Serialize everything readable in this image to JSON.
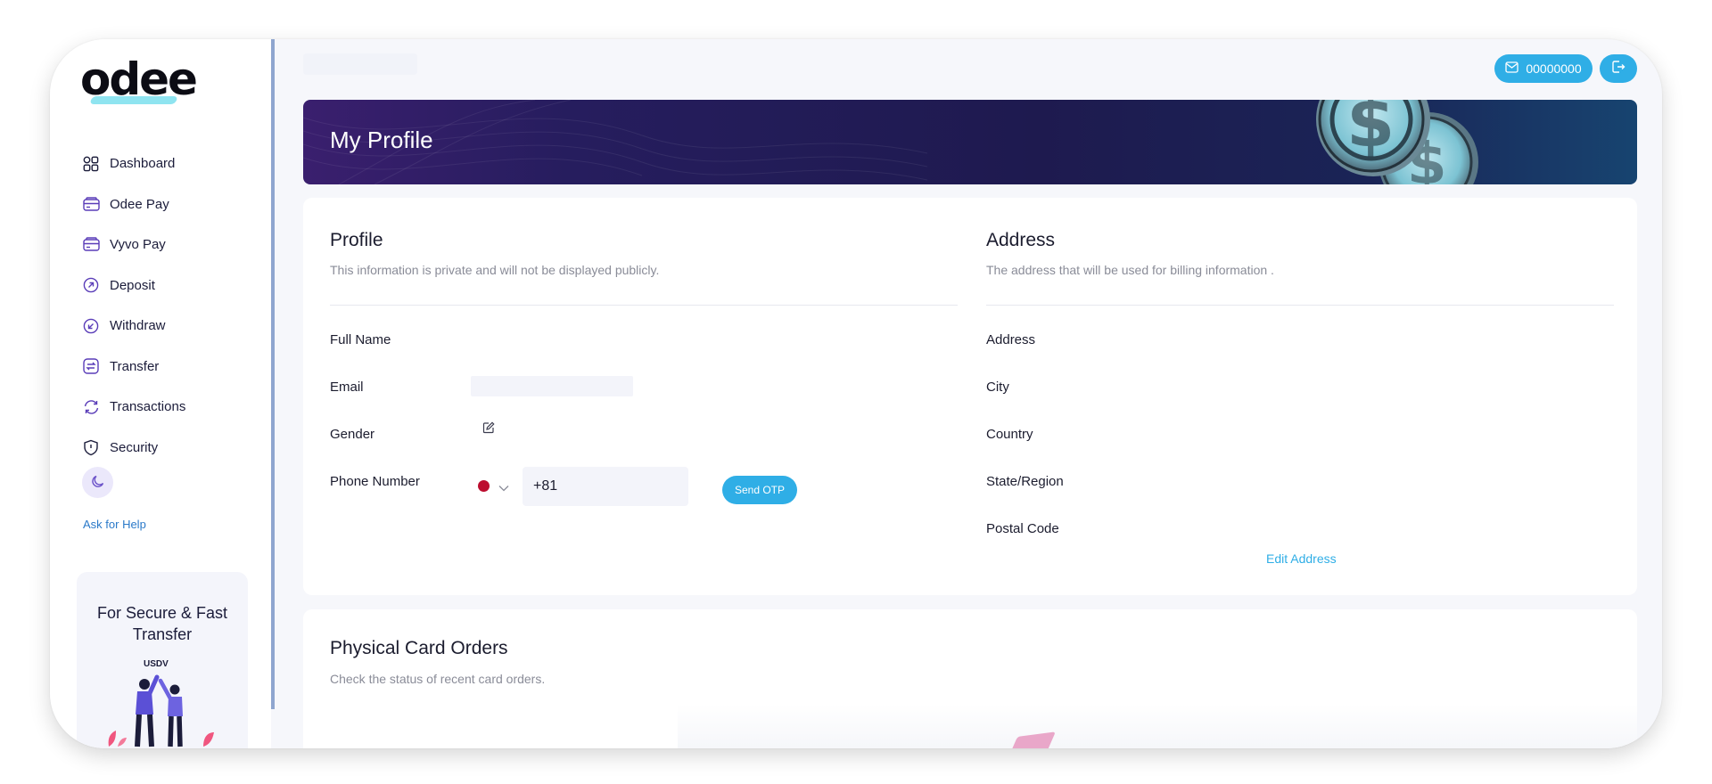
{
  "brand": {
    "logo_text": "odee",
    "accent": "#2faee6",
    "banner_gradient": [
      "#3a1f6e",
      "#174470"
    ]
  },
  "sidebar": {
    "items": [
      {
        "label": "Dashboard",
        "icon": "grid-icon"
      },
      {
        "label": "Odee Pay",
        "icon": "card-icon"
      },
      {
        "label": "Vyvo Pay",
        "icon": "card-icon"
      },
      {
        "label": "Deposit",
        "icon": "arrow-up-right-circle-icon"
      },
      {
        "label": "Withdraw",
        "icon": "arrow-down-left-circle-icon"
      },
      {
        "label": "Transfer",
        "icon": "swap-icon"
      },
      {
        "label": "Transactions",
        "icon": "refresh-icon"
      },
      {
        "label": "Security",
        "icon": "shield-icon"
      }
    ],
    "theme_toggle_icon": "moon-icon",
    "help_label": "Ask for Help",
    "promo": {
      "title": "For Secure & Fast Transfer",
      "art_label": "USDV"
    }
  },
  "header": {
    "email_label": "00000000",
    "email_icon": "mail-icon",
    "logout_icon": "logout-icon"
  },
  "banner": {
    "title": "My Profile",
    "art_icon": "dollar-coins-icon"
  },
  "profile": {
    "title": "Profile",
    "subtitle": "This information is private and will not be displayed publicly.",
    "fields": {
      "full_name_label": "Full Name",
      "email_label": "Email",
      "gender_label": "Gender",
      "phone_label": "Phone Number",
      "phone_value": "+81",
      "send_otp_label": "Send OTP"
    }
  },
  "address": {
    "title": "Address",
    "subtitle": "The address that will be used for billing information .",
    "fields": {
      "address_label": "Address",
      "city_label": "City",
      "country_label": "Country",
      "state_label": "State/Region",
      "postal_label": "Postal Code"
    },
    "edit_label": "Edit Address"
  },
  "orders": {
    "title": "Physical Card Orders",
    "subtitle": "Check the status of recent card orders."
  }
}
